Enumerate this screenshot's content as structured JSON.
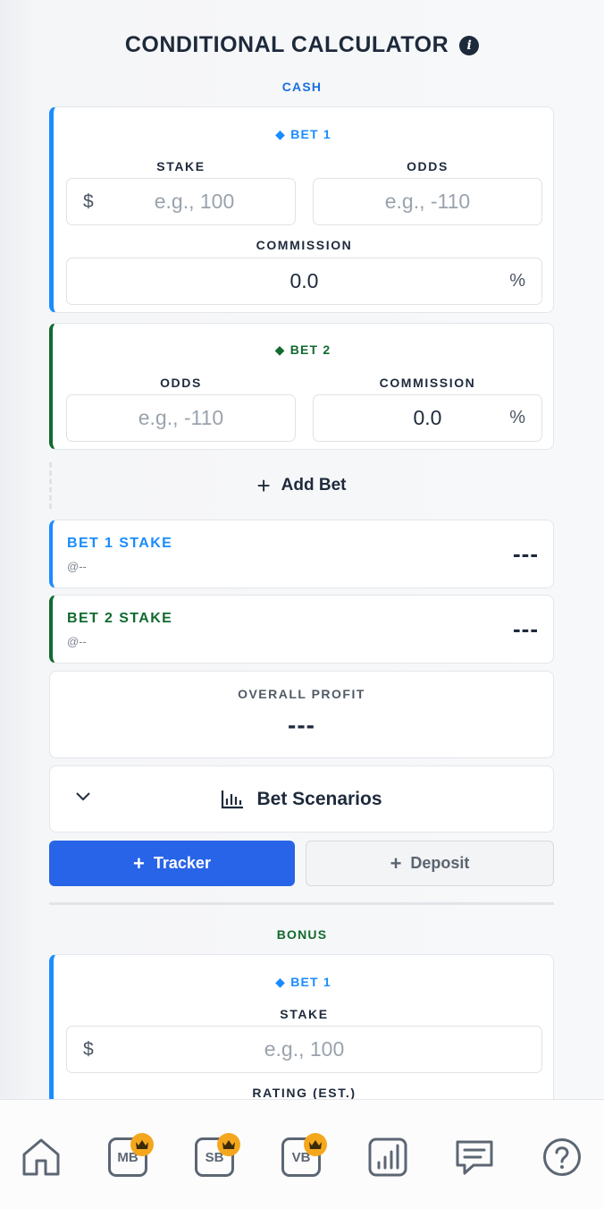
{
  "header": {
    "title": "CONDITIONAL CALCULATOR",
    "info_icon": "info-icon"
  },
  "cash": {
    "label": "CASH",
    "bet1": {
      "title": "BET 1",
      "stake_label": "STAKE",
      "stake_prefix": "$",
      "stake_placeholder": "e.g., 100",
      "odds_label": "ODDS",
      "odds_placeholder": "e.g., -110",
      "commission_label": "COMMISSION",
      "commission_value": "0.0",
      "commission_suffix": "%"
    },
    "bet2": {
      "title": "BET 2",
      "odds_label": "ODDS",
      "odds_placeholder": "e.g., -110",
      "commission_label": "COMMISSION",
      "commission_value": "0.0",
      "commission_suffix": "%"
    },
    "add_bet_label": "Add Bet",
    "results": {
      "bet1_stake_title": "BET 1 STAKE",
      "bet1_stake_sub": "@--",
      "bet1_stake_value": "---",
      "bet2_stake_title": "BET 2 STAKE",
      "bet2_stake_sub": "@--",
      "bet2_stake_value": "---",
      "profit_label": "OVERALL PROFIT",
      "profit_value": "---"
    },
    "scenarios_label": "Bet Scenarios",
    "tracker_label": "Tracker",
    "deposit_label": "Deposit"
  },
  "bonus": {
    "label": "BONUS",
    "bet1": {
      "title": "BET 1",
      "stake_label": "STAKE",
      "stake_prefix": "$",
      "stake_placeholder": "e.g., 100",
      "rating_label": "RATING (EST.)"
    }
  },
  "nav": {
    "items": [
      {
        "label": "",
        "icon": "home-icon"
      },
      {
        "label": "MB",
        "icon": "mb-icon"
      },
      {
        "label": "SB",
        "icon": "sb-icon"
      },
      {
        "label": "VB",
        "icon": "vb-icon"
      },
      {
        "label": "",
        "icon": "stats-icon"
      },
      {
        "label": "",
        "icon": "chat-icon"
      },
      {
        "label": "",
        "icon": "help-icon"
      }
    ]
  },
  "colors": {
    "bet1_accent": "#1a8cff",
    "bet2_accent": "#116a2f",
    "primary_button": "#2864e8",
    "crown_badge": "#f4a71d"
  }
}
